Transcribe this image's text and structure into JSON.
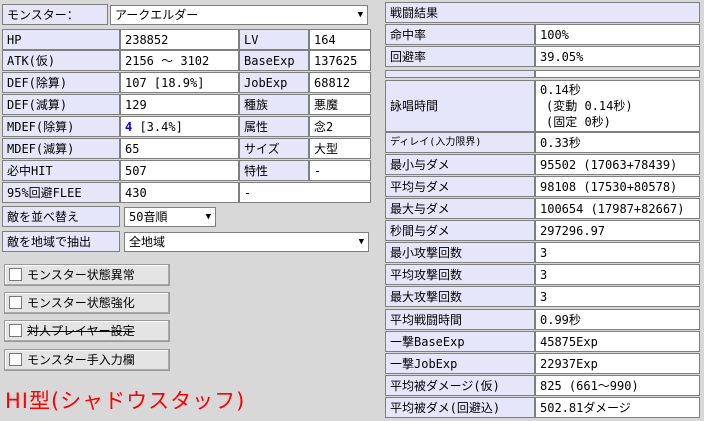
{
  "monster": {
    "label": "モンスター：",
    "selected": "アークエルダー"
  },
  "stats": {
    "hp_label": "HP",
    "hp": "238852",
    "lv_label": "LV",
    "lv": "164",
    "atk_label": "ATK(仮)",
    "atk": "2156 ～ 3102",
    "baseexp_label": "BaseExp",
    "baseexp": "137625",
    "def_div_label": "DEF(除算)",
    "def_div": "107 [18.9%]",
    "jobexp_label": "JobExp",
    "jobexp": "68812",
    "def_sub_label": "DEF(減算)",
    "def_sub": "129",
    "race_label": "種族",
    "race": "悪魔",
    "mdef_div_label": "MDEF(除算)",
    "mdef_div_num": "4",
    "mdef_div_rest": " [3.4%]",
    "element_label": "属性",
    "element": "念2",
    "mdef_sub_label": "MDEF(減算)",
    "mdef_sub": "65",
    "size_label": "サイズ",
    "size": "大型",
    "hit_label": "必中HIT",
    "hit": "507",
    "trait_label": "特性",
    "trait": "-",
    "flee_label": "95%回避FLEE",
    "flee": "430",
    "flee_extra": "-"
  },
  "sort": {
    "label": "敵を並べ替え",
    "selected": "50音順"
  },
  "region": {
    "label": "敵を地域で抽出",
    "selected": "全地域"
  },
  "checkboxes": [
    {
      "label": "モンスター状態異常"
    },
    {
      "label": "モンスター状態強化"
    },
    {
      "label": "対人プレイヤー設定"
    },
    {
      "label": "モンスター手入力欄"
    }
  ],
  "note": "HI型(シャドウスタッフ)",
  "battle": {
    "title": "戦闘結果",
    "hit_rate_label": "命中率",
    "hit_rate": "100%",
    "evade_label": "回避率",
    "evade": "39.05%",
    "cast_label": "詠唱時間",
    "cast_line1": "0.14秒",
    "cast_line2": "(変動 0.14秒)",
    "cast_line3": "(固定 0秒)",
    "delay_label": "ディレイ(入力限界)",
    "delay": "0.33秒",
    "rows": [
      {
        "label": "最小与ダメ",
        "value": "95502 (17063+78439)"
      },
      {
        "label": "平均与ダメ",
        "value": "98108 (17530+80578)"
      },
      {
        "label": "最大与ダメ",
        "value": "100654 (17987+82667)"
      },
      {
        "label": "秒間与ダメ",
        "value": "297296.97"
      },
      {
        "label": "最小攻撃回数",
        "value": "3"
      },
      {
        "label": "平均攻撃回数",
        "value": "3"
      },
      {
        "label": "最大攻撃回数",
        "value": "3"
      },
      {
        "label": "平均戦闘時間",
        "value": "0.99秒"
      },
      {
        "label": "一撃BaseExp",
        "value": "45875Exp"
      },
      {
        "label": "一撃JobExp",
        "value": "22937Exp"
      },
      {
        "label": "平均被ダメージ(仮)",
        "value": "825 (661～990)"
      },
      {
        "label": "平均被ダメ(回避込)",
        "value": "502.81ダメージ"
      }
    ]
  }
}
